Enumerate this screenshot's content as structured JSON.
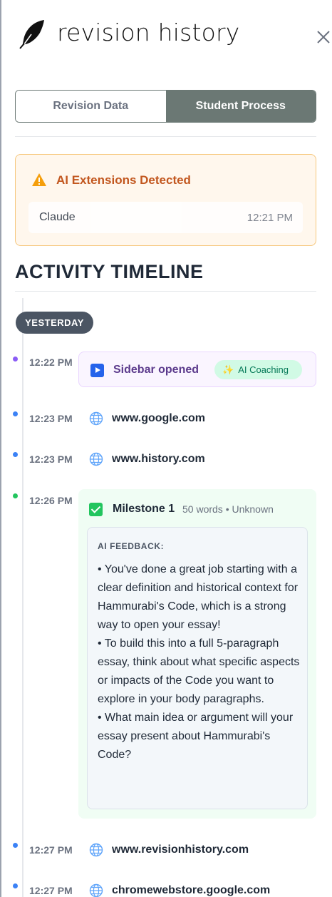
{
  "header": {
    "brand": "revision history"
  },
  "tabs": [
    {
      "label": "Revision Data",
      "active": false
    },
    {
      "label": "Student Process",
      "active": true
    }
  ],
  "alert": {
    "title": "AI Extensions Detected",
    "items": [
      {
        "name": "Claude",
        "time": "12:21 PM"
      }
    ]
  },
  "timeline": {
    "title": "ACTIVITY TIMELINE",
    "day_label": "YESTERDAY",
    "events": [
      {
        "time": "12:22 PM",
        "type": "sidebar",
        "label": "Sidebar opened",
        "badge": "AI Coaching"
      },
      {
        "time": "12:23 PM",
        "type": "url",
        "label": "www.google.com"
      },
      {
        "time": "12:23 PM",
        "type": "url",
        "label": "www.history.com"
      },
      {
        "time": "12:26 PM",
        "type": "milestone",
        "label": "Milestone 1",
        "meta": "50 words • Unknown",
        "feedback_label": "AI FEEDBACK:",
        "feedback": [
          "• You've done a great job starting with a clear definition and historical context for Hammurabi's Code, which is a strong way to open your essay!",
          "• To build this into a full 5-paragraph essay, think about what specific aspects or impacts of the Code you want to explore in your body paragraphs.",
          "• What main idea or argument will your essay present about Hammurabi's Code?"
        ]
      },
      {
        "time": "12:27 PM",
        "type": "url",
        "label": "www.revisionhistory.com"
      },
      {
        "time": "12:27 PM",
        "type": "url",
        "label": "chromewebstore.google.com"
      }
    ]
  },
  "colors": {
    "accent": "#6b7874",
    "alert_text": "#c2571f",
    "sidebar_event": "#8b5cf6",
    "url_event": "#3b82f6",
    "milestone_event": "#22c55e"
  },
  "icons": [
    "quill-logo-icon",
    "close-icon",
    "warning-icon",
    "play-icon",
    "sparkle-icon",
    "globe-icon",
    "checkbox-icon"
  ]
}
